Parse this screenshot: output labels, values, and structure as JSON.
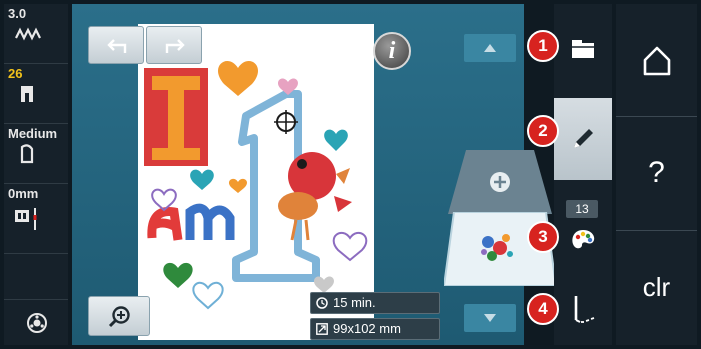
{
  "status_column": {
    "stitch_width": {
      "value": "3.0",
      "icon": "zigzag-stitch-icon"
    },
    "presser_foot": {
      "value": "26",
      "icon": "presser-foot-icon"
    },
    "foot_pressure": {
      "value": "Medium",
      "icon": "foot-pressure-icon"
    },
    "needle_offset": {
      "value": "0mm",
      "icon": "needle-position-icon"
    },
    "bobbin": {
      "icon": "bobbin-icon"
    }
  },
  "workspace": {
    "undo_icon": "undo-icon",
    "redo_icon": "redo-icon",
    "info_label": "i",
    "zoom_icon": "zoom-in-icon",
    "design_text": "I am 1",
    "stitch_time": "15 min.",
    "design_size": "99x102 mm"
  },
  "layers": {
    "add_icon": "plus-icon"
  },
  "tools": {
    "color_count": "13",
    "items": [
      {
        "icon": "folder-icon"
      },
      {
        "icon": "pencil-icon"
      },
      {
        "icon": "color-palette-icon"
      },
      {
        "icon": "embroidery-start-icon"
      }
    ]
  },
  "callouts": [
    "1",
    "2",
    "3",
    "4"
  ],
  "system": {
    "home_icon": "home-icon",
    "help_label": "?",
    "clear_label": "clr"
  },
  "colors": {
    "accent_red": "#d7231f",
    "workspace_blue": "#2b6f8a",
    "panel_dark": "#16212a"
  }
}
